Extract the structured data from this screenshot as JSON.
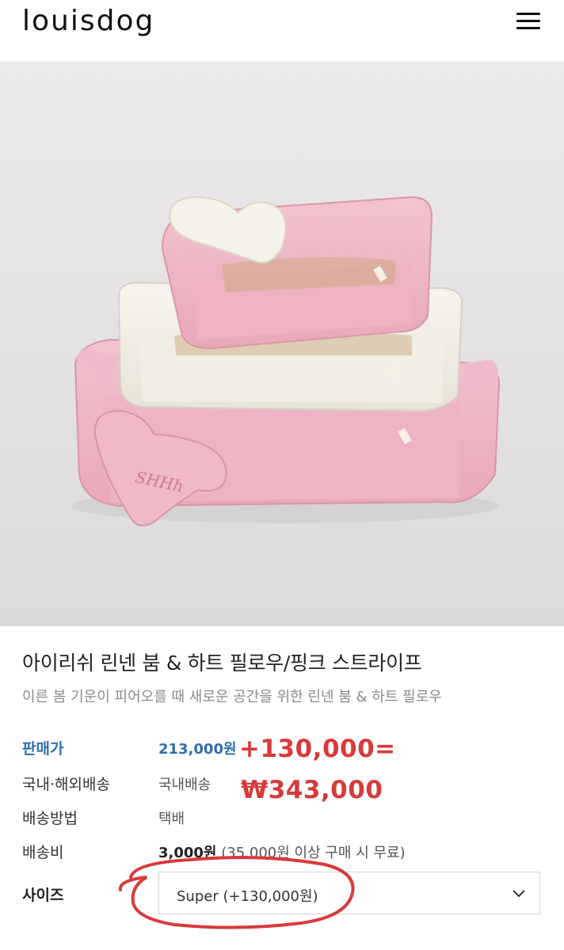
{
  "header": {
    "logo": "louisdog",
    "menu_icon": "hamburger-menu-icon"
  },
  "product": {
    "title": "아이리쉬 린넨 붐 & 하트 필로우/핑크 스트라이프",
    "description": "이른 봄 기운이 피어오를 때 새로운 공간을 위한 린넨 붐 & 하트 필로우",
    "photo_text": "SHHh"
  },
  "info": {
    "price_label": "판매가",
    "price_value": "213,000원",
    "shipping_region_label": "국내·해외배송",
    "shipping_region_value": "국내배송",
    "shipping_method_label": "배송방법",
    "shipping_method_value": "택배",
    "shipping_fee_label": "배송비",
    "shipping_fee_value": "3,000원",
    "shipping_fee_note": "(35,000원 이상 구매 시 무료)"
  },
  "option": {
    "size_label": "사이즈",
    "size_selected": "Super (+130,000원)"
  },
  "annotations": {
    "line1": "+130,000=",
    "line2": "₩343,000"
  },
  "colors": {
    "price_blue": "#2f6fae",
    "annotation_red": "#d83a3a",
    "bed_pink": "#eeb8c5",
    "bed_cream": "#f3f0e6"
  }
}
